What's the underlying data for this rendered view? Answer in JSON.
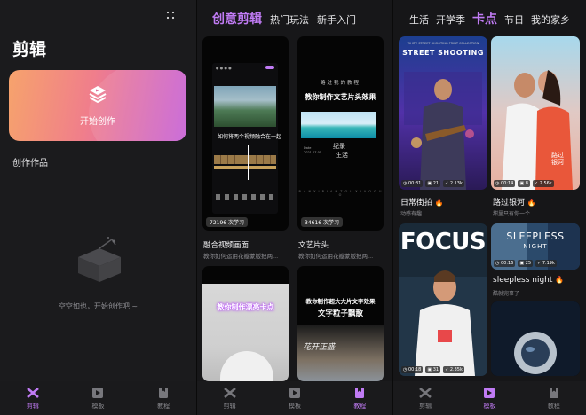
{
  "panel1": {
    "title": "剪辑",
    "create_label": "开始创作",
    "works_label": "创作作品",
    "empty_text": "空空如也，开始创作吧 ~"
  },
  "panel2": {
    "tabs": [
      {
        "label": "创意剪辑",
        "active": true
      },
      {
        "label": "热门玩法",
        "active": false
      },
      {
        "label": "新手入门",
        "active": false
      }
    ],
    "cards": [
      {
        "title": "融合视频画面",
        "desc": "教你如何运用花瓣蒙版把两...",
        "badge": "72196 次学习",
        "caption": "如何将两个视频融合在一起"
      },
      {
        "title": "文艺片头",
        "desc": "教你如何运用花瓣蒙版把两...",
        "badge": "34616 次学习",
        "small_text": "路过我的教程",
        "big_text": "教你制作文艺片头效果",
        "ji": "纪录",
        "sheng": "生活",
        "date_line1": "Date",
        "date_line2": "2021.07.05",
        "bottom_text": "R A N  Y I  P I A N  T O U  X I A O  G U O"
      },
      {
        "text": "教你制作漂亮卡点"
      },
      {
        "text1": "教你制作超大大片文字效果",
        "text2": "文字粒子飘散",
        "script": "花开正盛"
      }
    ]
  },
  "panel3": {
    "tabs": [
      {
        "label": "生活",
        "active": false
      },
      {
        "label": "开学季",
        "active": false
      },
      {
        "label": "卡点",
        "active": true
      },
      {
        "label": "节日",
        "active": false
      },
      {
        "label": "我的家乡",
        "active": false
      }
    ],
    "cards": [
      {
        "title": "日常街拍",
        "subtitle": "动感有趣",
        "cover_text": "STREET SHOOTING",
        "cover_small": "WHITE STREET SHOOTING PRINT COLLECTION",
        "duration": "00:31",
        "layers": "21",
        "uses": "2.13k"
      },
      {
        "title": "路过银河",
        "subtitle": "甜里只有你一个",
        "cover_text": "路过银河",
        "duration": "00:14",
        "layers": "8",
        "uses": "2.56k"
      },
      {
        "title": "sleepless night",
        "subtitle": "酷就完事了",
        "cover_text": "SLEEPLESS",
        "cover_text2": "NIGHT",
        "duration": "00:16",
        "layers": "25",
        "uses": "7.19k"
      },
      {
        "cover_text": "FOCUS",
        "duration": "00:18",
        "layers": "31",
        "uses": "2.35k"
      }
    ]
  },
  "bottom_nav": [
    {
      "label": "剪辑"
    },
    {
      "label": "模板"
    },
    {
      "label": "教程"
    }
  ],
  "colors": {
    "accent": "#c07bf4",
    "create_gradient_start": "#f6a36c",
    "create_gradient_end": "#c65fd6",
    "background": "#121212"
  }
}
